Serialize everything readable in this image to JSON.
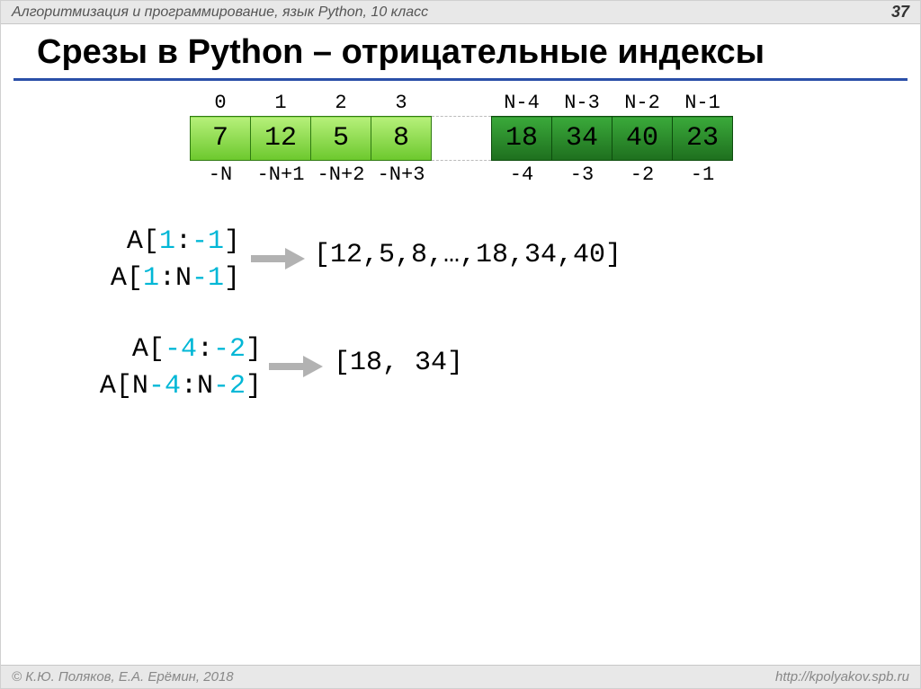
{
  "header": {
    "text": "Алгоритмизация и программирование, язык Python, 10 класс",
    "page": "37"
  },
  "title": "Срезы в Python – отрицательные индексы",
  "array": {
    "top_idx_left": [
      "0",
      "1",
      "2",
      "3"
    ],
    "top_idx_right": [
      "N-4",
      "N-3",
      "N-2",
      "N-1"
    ],
    "vals_left": [
      "7",
      "12",
      "5",
      "8"
    ],
    "vals_right": [
      "18",
      "34",
      "40",
      "23"
    ],
    "bot_idx_left": [
      "-N",
      "-N+1",
      "-N+2",
      "-N+3"
    ],
    "bot_idx_right": [
      "-4",
      "-3",
      "-2",
      "-1"
    ]
  },
  "ex1": {
    "line1": {
      "pre": "A[",
      "a": "1",
      "mid": ":",
      "b": "-1",
      "post": "]"
    },
    "line2": {
      "pre": "A[",
      "a": "1",
      "mid": ":N",
      "b": "-1",
      "post": "]"
    },
    "result": "[12,5,8,…,18,34,40]"
  },
  "ex2": {
    "line1": {
      "pre": "A[",
      "a": "-4",
      "mid": ":",
      "b": "-2",
      "post": "]"
    },
    "line2": {
      "pre": "A[N",
      "a": "-4",
      "mid": ":N",
      "b": "-2",
      "post": "]"
    },
    "result": "[18, 34]"
  },
  "footer": {
    "left": "© К.Ю. Поляков, Е.А. Ерёмин, 2018",
    "right": "http://kpolyakov.spb.ru"
  }
}
